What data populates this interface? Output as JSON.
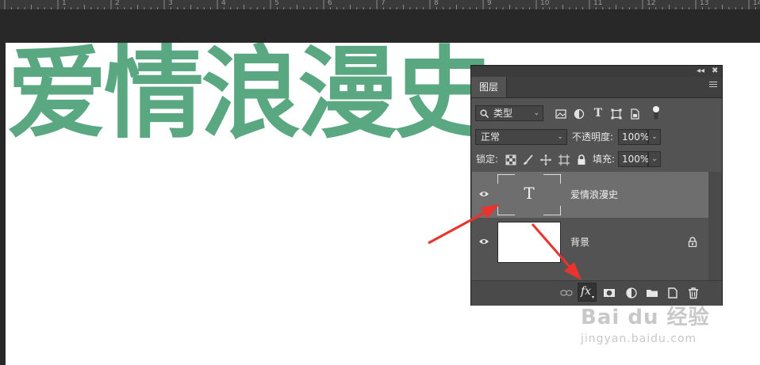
{
  "ruler": {
    "numbers": [
      "1",
      "2",
      "3",
      "4",
      "5",
      "6",
      "7",
      "8",
      "9",
      "10",
      "11",
      "12",
      "13",
      "14"
    ]
  },
  "canvas": {
    "text": "爱情浪漫史",
    "text_color": "#5aa882",
    "background": "#ffffff"
  },
  "panel": {
    "tab": "图层",
    "filter": {
      "value": "类型"
    },
    "blend_mode": "正常",
    "opacity": {
      "label": "不透明度:",
      "value": "100%"
    },
    "lock_label": "锁定:",
    "fill": {
      "label": "填充:",
      "value": "100%"
    },
    "layers": [
      {
        "name": "爱情浪漫史",
        "type": "text",
        "thumb_glyph": "T",
        "selected": true,
        "visible": true,
        "locked": false
      },
      {
        "name": "背景",
        "type": "background",
        "selected": false,
        "visible": true,
        "locked": true
      }
    ],
    "bottom_icons": [
      "link-icon",
      "fx-icon",
      "mask-icon",
      "adjustment-icon",
      "folder-icon",
      "new-layer-icon",
      "trash-icon"
    ],
    "fx_label": "fx"
  },
  "annotation": {
    "arrow_color": "#e8332e"
  },
  "watermark": {
    "brand": "Bai du 经验",
    "url": "jingyan.baidu.com"
  }
}
